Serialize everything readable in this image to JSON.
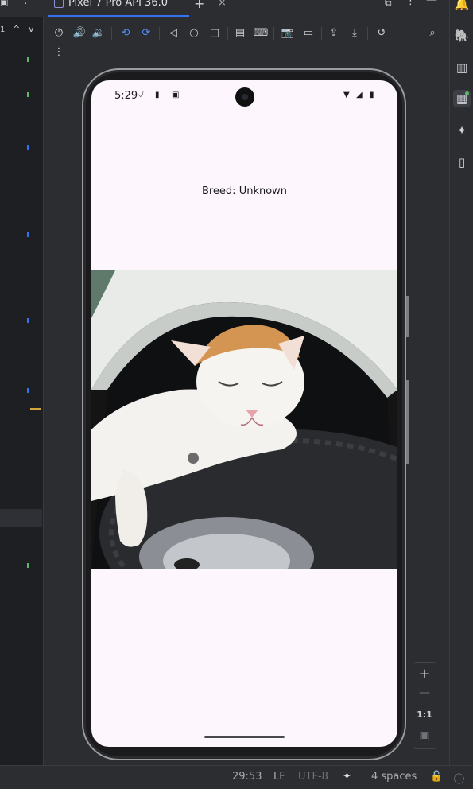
{
  "window": {
    "tab_title": "Pixel 7 Pro API 36.0",
    "tab_close": "×",
    "new_tab": "+"
  },
  "gutter": {
    "line_indicator": "1",
    "prev_glyph": "^",
    "next_glyph": "v"
  },
  "toolbar": {
    "more_glyph": "⋮",
    "buttons": [
      "power-icon",
      "volume-up-icon",
      "volume-down-icon",
      "rotate-left-icon",
      "rotate-right-icon",
      "back-icon",
      "home-icon",
      "overview-icon",
      "fold-icon",
      "keyboard-icon",
      "camera-icon",
      "screenrecord-icon",
      "export-icon",
      "import-icon",
      "reset-icon",
      "search-icon"
    ]
  },
  "device": {
    "status_time": "5:29",
    "breed_text": "Breed: Unknown",
    "image_description": "white and orange cat sleeping on a car tire"
  },
  "zoom": {
    "plus": "+",
    "minus": "—",
    "ratio": "1:1"
  },
  "footer": {
    "position": "29:53",
    "line_ending": "LF",
    "encoding": "UTF-8",
    "indent": "4 spaces"
  },
  "colors": {
    "ide_bg": "#2b2d30",
    "editor_bg": "#1e1f22",
    "accent": "#3574f0",
    "screen_bg": "#fdf6fd"
  }
}
